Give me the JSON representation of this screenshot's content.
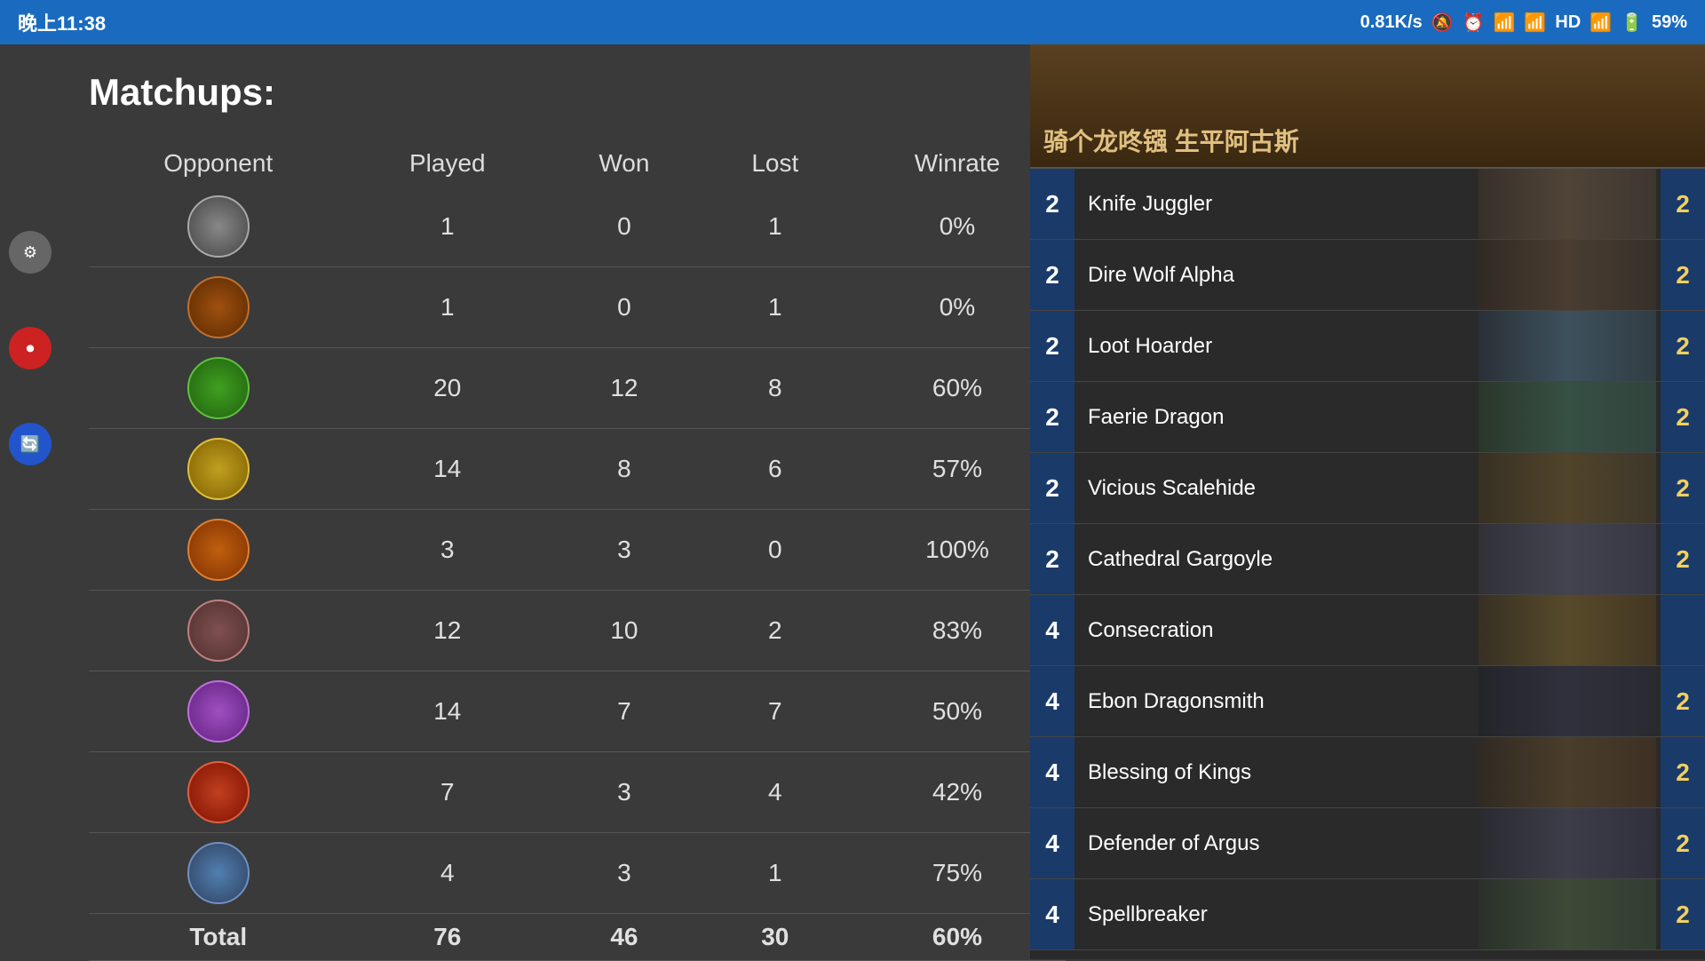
{
  "statusBar": {
    "time": "晚上11:38",
    "speed": "0.81K/s",
    "icons": "🔕 ⏰ 📶 📶 HD 🔋",
    "battery": "59%"
  },
  "matchups": {
    "title": "Matchups:",
    "columns": [
      "Opponent",
      "Played",
      "Won",
      "Lost",
      "Winrate"
    ],
    "rows": [
      {
        "icon": "icon-rogue",
        "played": "1",
        "won": "0",
        "lost": "1",
        "winrate": "0%"
      },
      {
        "icon": "icon-shaman",
        "played": "1",
        "won": "0",
        "lost": "1",
        "winrate": "0%"
      },
      {
        "icon": "icon-druid",
        "played": "20",
        "won": "12",
        "lost": "8",
        "winrate": "60%"
      },
      {
        "icon": "icon-paladin",
        "played": "14",
        "won": "8",
        "lost": "6",
        "winrate": "57%"
      },
      {
        "icon": "icon-hunter",
        "played": "3",
        "won": "3",
        "lost": "0",
        "winrate": "100%"
      },
      {
        "icon": "icon-warrior",
        "played": "12",
        "won": "10",
        "lost": "2",
        "winrate": "83%"
      },
      {
        "icon": "icon-mage",
        "played": "14",
        "won": "7",
        "lost": "7",
        "winrate": "50%"
      },
      {
        "icon": "icon-warlock",
        "played": "7",
        "won": "3",
        "lost": "4",
        "winrate": "42%"
      },
      {
        "icon": "icon-priest",
        "played": "4",
        "won": "3",
        "lost": "1",
        "winrate": "75%"
      }
    ],
    "total": {
      "label": "Total",
      "played": "76",
      "won": "46",
      "lost": "30",
      "winrate": "60%"
    }
  },
  "deck": {
    "header": "骑个龙咚镪 生平阿古斯",
    "cards": [
      {
        "cost": "2",
        "name": "Knife Juggler",
        "count": "2",
        "art": "art-knife"
      },
      {
        "cost": "2",
        "name": "Dire Wolf Alpha",
        "count": "2",
        "art": "art-dire-wolf"
      },
      {
        "cost": "2",
        "name": "Loot Hoarder",
        "count": "2",
        "art": "art-loot"
      },
      {
        "cost": "2",
        "name": "Faerie Dragon",
        "count": "2",
        "art": "art-faerie"
      },
      {
        "cost": "2",
        "name": "Vicious Scalehide",
        "count": "2",
        "art": "art-vicious"
      },
      {
        "cost": "2",
        "name": "Cathedral Gargoyle",
        "count": "2",
        "art": "art-cathedral"
      },
      {
        "cost": "4",
        "name": "Consecration",
        "count": "",
        "art": "art-consecration"
      },
      {
        "cost": "4",
        "name": "Ebon Dragonsmith",
        "count": "2",
        "art": "art-ebon"
      },
      {
        "cost": "4",
        "name": "Blessing of Kings",
        "count": "2",
        "art": "art-blessing"
      },
      {
        "cost": "4",
        "name": "Defender of Argus",
        "count": "2",
        "art": "art-defender"
      },
      {
        "cost": "4",
        "name": "Spellbreaker",
        "count": "2",
        "art": "art-spellbreaker"
      }
    ]
  },
  "sideIcons": {
    "gear": "⚙",
    "record": "⏺",
    "sync": "🔄"
  }
}
